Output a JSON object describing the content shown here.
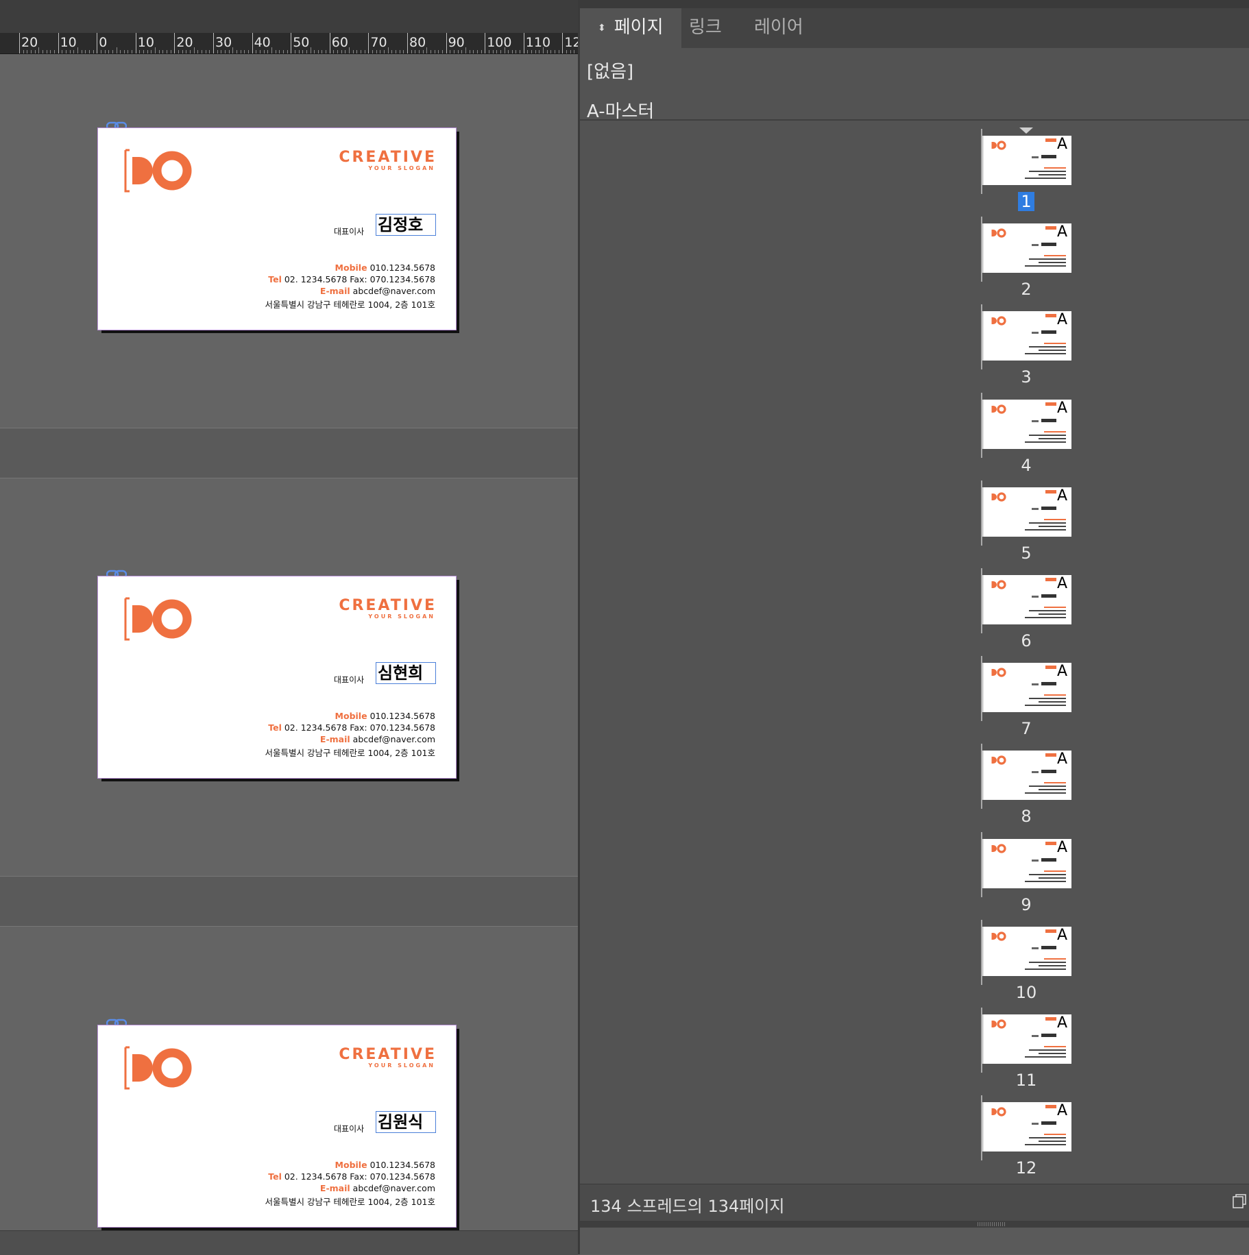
{
  "ruler": {
    "labels": [
      "20",
      "10",
      "0",
      "10",
      "20",
      "30",
      "40",
      "50",
      "60",
      "70",
      "80",
      "90",
      "100",
      "110",
      "12"
    ]
  },
  "cards": [
    {
      "creative": "CREATIVE",
      "slogan": "YOUR SLOGAN",
      "title": "대표이사",
      "name": "김정호",
      "mobile_key": "Mobile",
      "mobile": "010.1234.5678",
      "tel_key": "Tel",
      "tel": "02. 1234.5678 Fax: 070.1234.5678",
      "email_key": "E-mail",
      "email": "abcdef@naver.com",
      "address": "서울특별시 강남구 테헤란로 1004, 2층 101호"
    },
    {
      "creative": "CREATIVE",
      "slogan": "YOUR SLOGAN",
      "title": "대표이사",
      "name": "심현희",
      "mobile_key": "Mobile",
      "mobile": "010.1234.5678",
      "tel_key": "Tel",
      "tel": "02. 1234.5678 Fax: 070.1234.5678",
      "email_key": "E-mail",
      "email": "abcdef@naver.com",
      "address": "서울특별시 강남구 테헤란로 1004, 2층 101호"
    },
    {
      "creative": "CREATIVE",
      "slogan": "YOUR SLOGAN",
      "title": "대표이사",
      "name": "김원식",
      "mobile_key": "Mobile",
      "mobile": "010.1234.5678",
      "tel_key": "Tel",
      "tel": "02. 1234.5678 Fax: 070.1234.5678",
      "email_key": "E-mail",
      "email": "abcdef@naver.com",
      "address": "서울특별시 강남구 테헤란로 1004, 2층 101호"
    }
  ],
  "panel": {
    "tabs": [
      "페이지",
      "링크",
      "레이어"
    ],
    "masters": [
      "[없음]",
      "A-마스터"
    ],
    "pages": [
      {
        "num": "1",
        "selected": true,
        "master": "A"
      },
      {
        "num": "2",
        "master": "A"
      },
      {
        "num": "3",
        "master": "A"
      },
      {
        "num": "4",
        "master": "A"
      },
      {
        "num": "5",
        "master": "A"
      },
      {
        "num": "6",
        "master": "A"
      },
      {
        "num": "7",
        "master": "A"
      },
      {
        "num": "8",
        "master": "A"
      },
      {
        "num": "9",
        "master": "A"
      },
      {
        "num": "10",
        "master": "A"
      },
      {
        "num": "11",
        "master": "A"
      },
      {
        "num": "12",
        "master": "A"
      }
    ],
    "footer": "134 스프레드의 134페이지"
  },
  "colors": {
    "accent": "#ef7040",
    "selection": "#2f7de1",
    "frame": "#4a7fd8"
  },
  "icons": [
    "sort-icon",
    "chain-link-icon",
    "new-page-icon",
    "do-logo"
  ]
}
